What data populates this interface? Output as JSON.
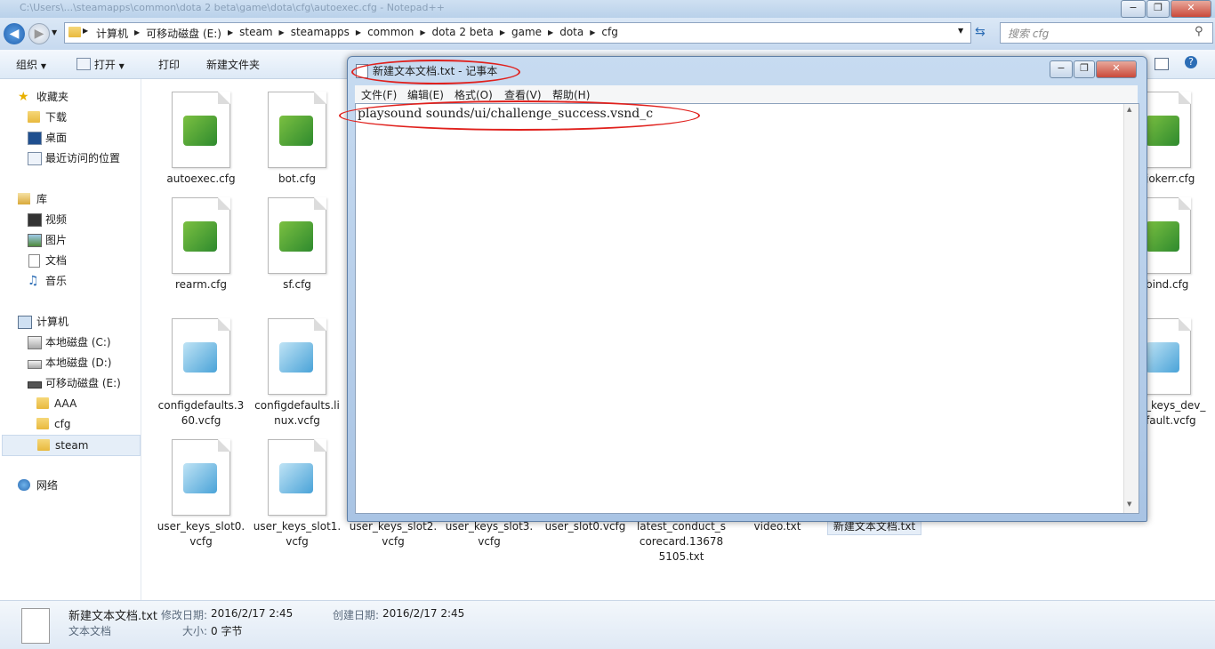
{
  "window": {
    "path_title": "C:\\Users\\...\\steamapps\\common\\dota 2 beta\\game\\dota\\cfg\\autoexec.cfg - Notepad++",
    "controls": {
      "minimize": "−",
      "restore": "❐",
      "close": "✕"
    }
  },
  "address": {
    "crumbs": [
      "计算机",
      "可移动磁盘 (E:)",
      "steam",
      "steamapps",
      "common",
      "dota 2 beta",
      "game",
      "dota",
      "cfg"
    ],
    "search_placeholder": "搜索 cfg"
  },
  "toolbar": {
    "organize": "组织",
    "open": "打开",
    "print": "打印",
    "new_folder": "新建文件夹"
  },
  "sidebar": {
    "favorites": "收藏夹",
    "downloads": "下载",
    "desktop": "桌面",
    "recent": "最近访问的位置",
    "libraries": "库",
    "videos": "视频",
    "pictures": "图片",
    "documents": "文档",
    "music": "音乐",
    "computer": "计算机",
    "drive_c": "本地磁盘 (C:)",
    "drive_d": "本地磁盘 (D:)",
    "drive_e": "可移动磁盘 (E:)",
    "aaa": "AAA",
    "cfg": "cfg",
    "steam": "steam",
    "network": "网络"
  },
  "files": {
    "autoexec": "autoexec.cfg",
    "bot": "bot.cfg",
    "rearm": "rearm.cfg",
    "sf": "sf.cfg",
    "cfgdef360_a": "configdefaults.3",
    "cfgdef360_b": "60.vcfg",
    "cfgdeflinux_a": "configdefaults.li",
    "cfgdeflinux_b": "nux.vcfg",
    "uks0_a": "user_keys_slot0.",
    "uks0_b": "vcfg",
    "uks1_a": "user_keys_slot1.",
    "uks1_b": "vcfg",
    "uks2_a": "user_keys_slot2.",
    "uks2_b": "vcfg",
    "uks3_a": "user_keys_slot3.",
    "uks3_b": "vcfg",
    "us0": "user_slot0.vcfg",
    "lcs_a": "latest_conduct_s",
    "lcs_b": "corecard.13678",
    "lcs_c": "5105.txt",
    "video": "video.txt",
    "newtxt": "新建文本文档.txt",
    "jokerr": "jokerr.cfg",
    "bind": "bind.cfg",
    "keysdev_a": "_keys_dev_",
    "keysdev_b": "fault.vcfg"
  },
  "notepad": {
    "title": "新建文本文档.txt - 记事本",
    "menus": [
      "文件(F)",
      "编辑(E)",
      "格式(O)",
      "查看(V)",
      "帮助(H)"
    ],
    "content": "playsound sounds/ui/challenge_success.vsnd_c"
  },
  "details": {
    "name": "新建文本文档.txt",
    "type": "文本文档",
    "modified_label": "修改日期:",
    "modified_value": "2016/2/17 2:45",
    "created_label": "创建日期:",
    "created_value": "2016/2/17 2:45",
    "size_label": "大小:",
    "size_value": "0 字节"
  },
  "colors": {
    "accent": "#3399ff",
    "highlight_ring": "#e0201c"
  }
}
